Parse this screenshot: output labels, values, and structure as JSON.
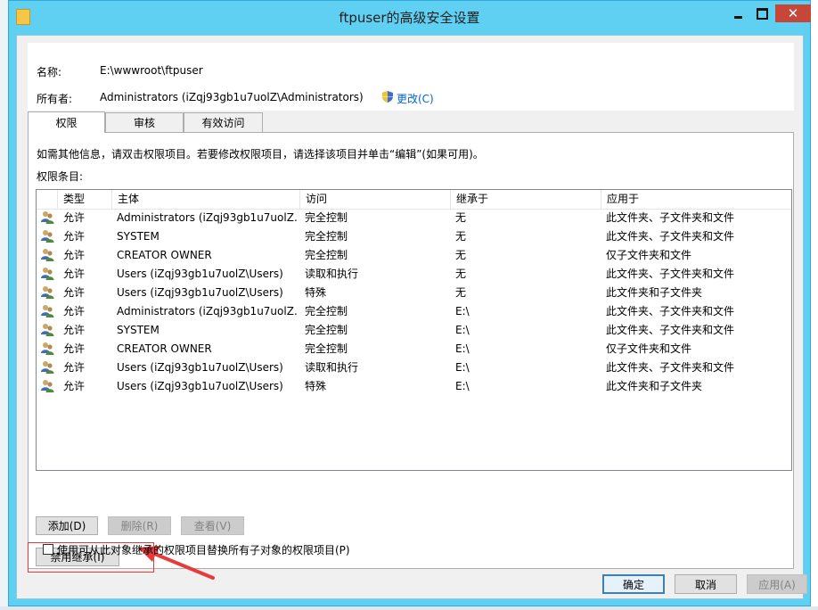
{
  "window": {
    "title": "ftpuser的高级安全设置"
  },
  "info": {
    "name_label": "名称:",
    "name_value": "E:\\wwwroot\\ftpuser",
    "owner_label": "所有者:",
    "owner_value": "Administrators (iZqj93gb1u7uolZ\\Administrators)",
    "change_link": "更改(C)"
  },
  "tabs": [
    {
      "label": "权限"
    },
    {
      "label": "审核"
    },
    {
      "label": "有效访问"
    }
  ],
  "panel": {
    "hint": "如需其他信息，请双击权限项目。若要修改权限项目，请选择该项目并单击“编辑”(如果可用)。",
    "entries_label": "权限条目:"
  },
  "table": {
    "headers": [
      "类型",
      "主体",
      "访问",
      "继承于",
      "应用于"
    ],
    "rows": [
      {
        "type": "允许",
        "principal": "Administrators (iZqj93gb1u7uolZ...",
        "access": "完全控制",
        "inherited": "无",
        "applies": "此文件夹、子文件夹和文件"
      },
      {
        "type": "允许",
        "principal": "SYSTEM",
        "access": "完全控制",
        "inherited": "无",
        "applies": "此文件夹、子文件夹和文件"
      },
      {
        "type": "允许",
        "principal": "CREATOR OWNER",
        "access": "完全控制",
        "inherited": "无",
        "applies": "仅子文件夹和文件"
      },
      {
        "type": "允许",
        "principal": "Users (iZqj93gb1u7uolZ\\Users)",
        "access": "读取和执行",
        "inherited": "无",
        "applies": "此文件夹、子文件夹和文件"
      },
      {
        "type": "允许",
        "principal": "Users (iZqj93gb1u7uolZ\\Users)",
        "access": "特殊",
        "inherited": "无",
        "applies": "此文件夹和子文件夹"
      },
      {
        "type": "允许",
        "principal": "Administrators (iZqj93gb1u7uolZ...",
        "access": "完全控制",
        "inherited": "E:\\",
        "applies": "此文件夹、子文件夹和文件"
      },
      {
        "type": "允许",
        "principal": "SYSTEM",
        "access": "完全控制",
        "inherited": "E:\\",
        "applies": "此文件夹、子文件夹和文件"
      },
      {
        "type": "允许",
        "principal": "CREATOR OWNER",
        "access": "完全控制",
        "inherited": "E:\\",
        "applies": "仅子文件夹和文件"
      },
      {
        "type": "允许",
        "principal": "Users (iZqj93gb1u7uolZ\\Users)",
        "access": "读取和执行",
        "inherited": "E:\\",
        "applies": "此文件夹、子文件夹和文件"
      },
      {
        "type": "允许",
        "principal": "Users (iZqj93gb1u7uolZ\\Users)",
        "access": "特殊",
        "inherited": "E:\\",
        "applies": "此文件夹和子文件夹"
      }
    ]
  },
  "buttons": {
    "add": "添加(D)",
    "remove": "删除(R)",
    "view": "查看(V)",
    "disable_inheritance": "禁用继承(I)",
    "ok": "确定",
    "cancel": "取消",
    "apply": "应用(A)"
  },
  "checkbox": {
    "replace_label": "使用可从此对象继承的权限项目替换所有子对象的权限项目(P)"
  },
  "colors": {
    "titlebar": "#5fd0f2",
    "close_button": "#c7463a",
    "highlight_red": "#e83a3a",
    "link": "#0066cc"
  }
}
